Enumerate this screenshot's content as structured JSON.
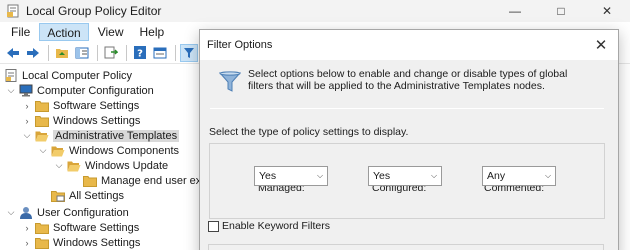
{
  "window": {
    "title": "Local Group Policy Editor",
    "controls": {
      "minimize": "—",
      "maximize": "□",
      "close": "✕"
    }
  },
  "menu": [
    "File",
    "Action",
    "View",
    "Help"
  ],
  "active_menu": "Action",
  "tree": {
    "root": "Local Computer Policy",
    "computer_config": "Computer Configuration",
    "software_settings": "Software Settings",
    "windows_settings": "Windows Settings",
    "admin_templates": "Administrative Templates",
    "windows_components": "Windows Components",
    "windows_update": "Windows Update",
    "manage_end_user": "Manage end user expe",
    "all_settings": "All Settings",
    "user_config": "User Configuration",
    "user_software_settings": "Software Settings",
    "user_windows_settings": "Windows Settings"
  },
  "dialog": {
    "title": "Filter Options",
    "description": "Select options below to enable and change or disable types of global filters that will be applied to the Administrative Templates nodes.",
    "select_label": "Select the type of policy settings to display.",
    "managed_label": "Managed:",
    "managed_value": "Yes",
    "configured_label": "Configured:",
    "configured_value": "Yes",
    "commented_label": "Commented:",
    "commented_value": "Any",
    "keyword_label": "Enable Keyword Filters",
    "keyword_checked": false
  },
  "colors": {
    "folder": "#e8b84a",
    "selection": "#d9d9d9",
    "menu_active": "#cce4f7",
    "dialog_body": "#f0f0f0"
  }
}
